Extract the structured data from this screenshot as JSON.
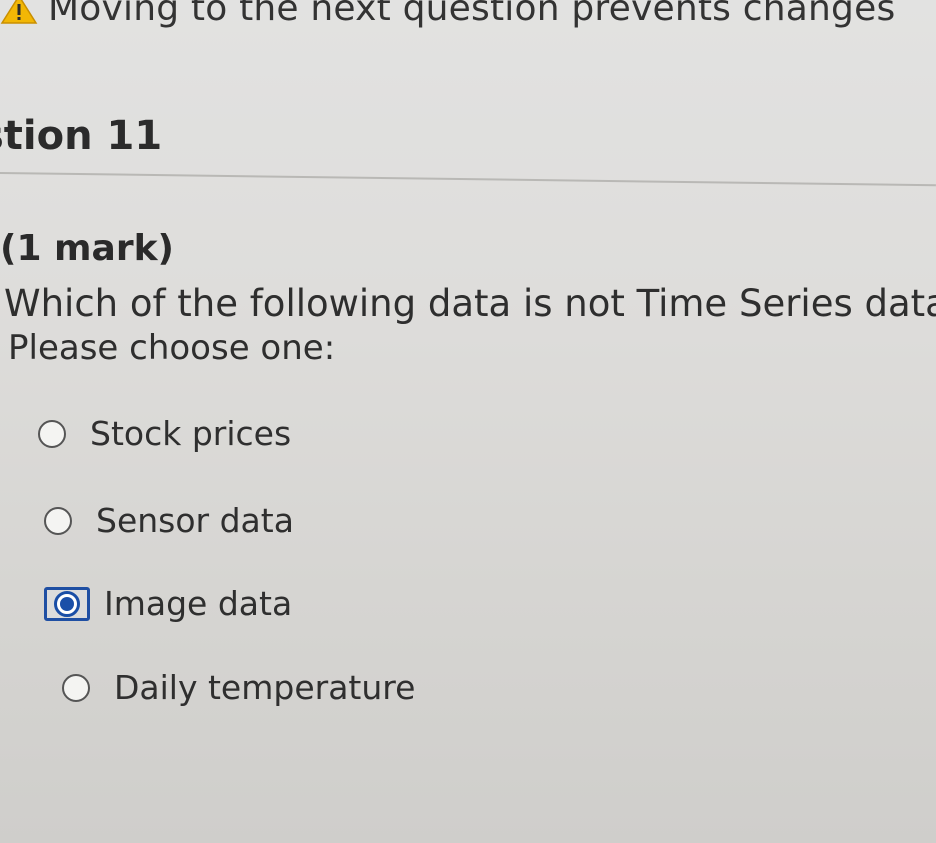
{
  "warning": {
    "text": "Moving to the next question prevents changes"
  },
  "question": {
    "title": "stion 11",
    "marks": "(1 mark)",
    "text": "Which of the following data is not Time Series data",
    "prompt": "Please choose one:"
  },
  "options": [
    {
      "label": "Stock prices",
      "selected": false
    },
    {
      "label": "Sensor data",
      "selected": false
    },
    {
      "label": "Image data",
      "selected": true
    },
    {
      "label": "Daily temperature",
      "selected": false
    }
  ],
  "colors": {
    "accent": "#1b4fa8",
    "warning": "#f2b705"
  }
}
